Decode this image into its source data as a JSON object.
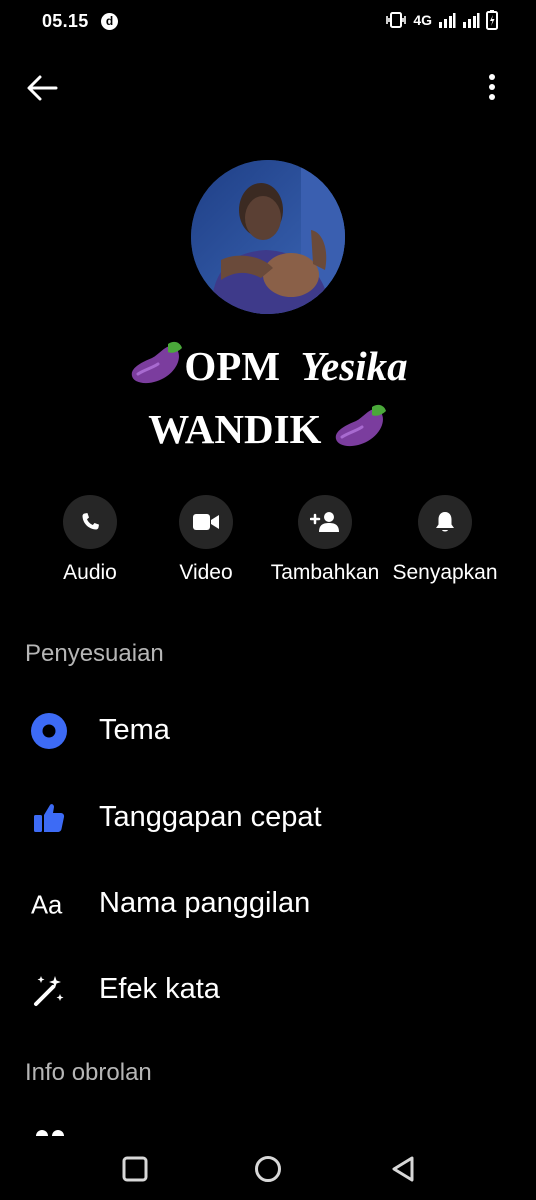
{
  "status_bar": {
    "time": "05.15",
    "badge": "d",
    "network": "4G"
  },
  "profile": {
    "name_line1_a": "OPM",
    "name_line1_b": "Yesika",
    "name_line2": "WANDIK"
  },
  "actions": [
    {
      "label": "Audio",
      "icon": "phone-icon"
    },
    {
      "label": "Video",
      "icon": "video-camera-icon"
    },
    {
      "label": "Tambahkan",
      "icon": "add-person-icon"
    },
    {
      "label": "Senyapkan",
      "icon": "bell-icon"
    }
  ],
  "sections": {
    "customization": {
      "title": "Penyesuaian",
      "items": [
        {
          "label": "Tema",
          "icon": "theme-dot-icon"
        },
        {
          "label": "Tanggapan cepat",
          "icon": "thumbs-up-icon"
        },
        {
          "label": "Nama panggilan",
          "icon": "aa-text-icon"
        },
        {
          "label": "Efek kata",
          "icon": "magic-wand-icon"
        }
      ]
    },
    "chat_info": {
      "title": "Info obrolan"
    }
  },
  "colors": {
    "accent": "#3d6bf5",
    "background": "#000000",
    "action_circle": "#262626",
    "section_title": "#b6b6b6"
  }
}
